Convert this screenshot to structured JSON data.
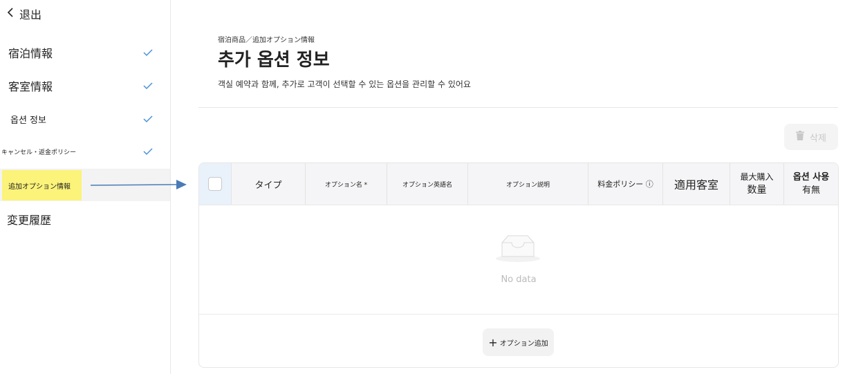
{
  "sidebar": {
    "exit_label": "退出",
    "items": [
      {
        "label": "宿泊情報",
        "checked": true
      },
      {
        "label": "客室情報",
        "checked": true
      },
      {
        "label": "옵션 정보",
        "checked": true
      },
      {
        "label": "キャンセル・返金ポリシー",
        "checked": true
      },
      {
        "label": "追加オプション情報",
        "checked": false,
        "active": true
      },
      {
        "label": "変更履歴",
        "checked": false
      }
    ]
  },
  "header": {
    "breadcrumb": "宿泊商品／追加オプション情報",
    "title": "추가 옵션 정보",
    "description": "객실 예약과 함께, 추가로 고객이 선택할 수 있는 옵션을 관리할 수 있어요"
  },
  "toolbar": {
    "delete_label": "삭제"
  },
  "table": {
    "columns": [
      {
        "label": "タイプ"
      },
      {
        "label": "オプション名 *"
      },
      {
        "label": "オプション英語名"
      },
      {
        "label": "オプション説明"
      },
      {
        "label": "料金ポリシー ⓘ"
      },
      {
        "label": "適用客室"
      },
      {
        "label_line1": "最大購入",
        "label_line2": "数量"
      },
      {
        "label_line1": "옵션 사용",
        "label_line2": "有無"
      }
    ],
    "empty_text": "No data",
    "add_label": "オプション追加"
  },
  "colors": {
    "check": "#4a90d9",
    "highlight": "#fbf37a",
    "arrow": "#4a7bb7",
    "header_bg": "#f5f5f7"
  }
}
